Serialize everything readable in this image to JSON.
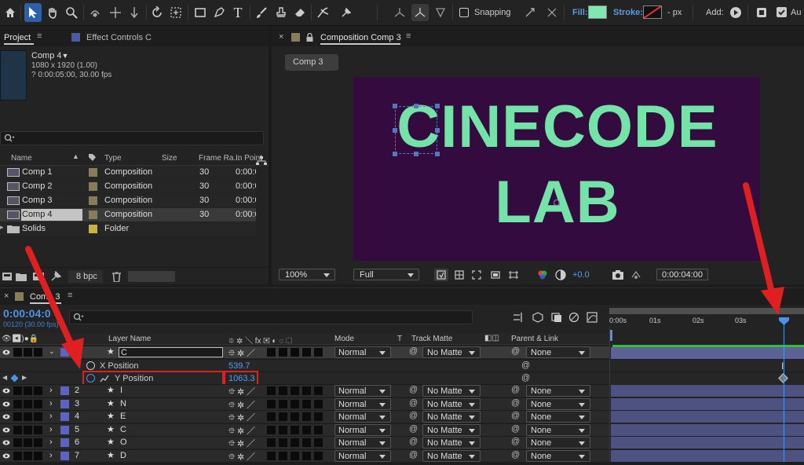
{
  "toolbar": {
    "tools": [
      "home-icon",
      "selection-icon",
      "hand-icon",
      "zoom-icon",
      "orbit-icon",
      "pan-icon",
      "dolly-icon",
      "rotate-icon",
      "pan-behind-icon",
      "rectangle-icon",
      "pen-icon",
      "type-icon",
      "brush-icon",
      "clone-stamp-icon",
      "eraser-icon",
      "roto-brush-icon",
      "puppet-icon"
    ],
    "snapping_label": "Snapping",
    "fill_label": "Fill:",
    "stroke_label": "Stroke:",
    "stroke_unit": "- px",
    "add_label": "Add:",
    "cut_label": "Au",
    "fill_color": "#7ee8b0",
    "stroke_color": "#e53030"
  },
  "project": {
    "tab_label": "Project",
    "effects_tab_label": "Effect Controls C",
    "selected_name": "Comp 4",
    "selected_info1": "1080 x 1920 (1.00)",
    "selected_info2": "? 0:00:05:00, 30.00 fps",
    "search_placeholder": "",
    "columns": {
      "name": "Name",
      "type": "Type",
      "size": "Size",
      "frame_rate": "Frame Ra...",
      "in_point": "In Point"
    },
    "items": [
      {
        "name": "Comp 1",
        "type": "Composition",
        "frame_rate": "30",
        "in_point": "0:00:0",
        "label_color": "#8a7c5a"
      },
      {
        "name": "Comp 2",
        "type": "Composition",
        "frame_rate": "30",
        "in_point": "0:00:0",
        "label_color": "#8a7c5a"
      },
      {
        "name": "Comp 3",
        "type": "Composition",
        "frame_rate": "30",
        "in_point": "0:00:0",
        "label_color": "#8a7c5a"
      },
      {
        "name": "Comp 4",
        "type": "Composition",
        "frame_rate": "30",
        "in_point": "0:00:0",
        "label_color": "#8a7c5a"
      },
      {
        "name": "Solids",
        "type": "Folder",
        "frame_rate": "",
        "in_point": "",
        "label_color": "#c9b33a"
      }
    ],
    "bpc_label": "8 bpc"
  },
  "composition": {
    "tab_label": "Composition Comp 3",
    "breadcrumb": "Comp 3",
    "canvas_bg": "#330b3f",
    "text_color": "#73e3a8",
    "line1": "CINECODE",
    "line2": "LAB",
    "zoom": "100%",
    "resolution": "Full",
    "exposure": "+0.0",
    "timecode": "0:00:04:00"
  },
  "timeline": {
    "tab_label": "Comp 3",
    "current_time": "0:00:04:0",
    "frame_info": "00120 (30.00 fps)",
    "col_layer_name": "Layer Name",
    "col_mode": "Mode",
    "col_t": "T",
    "col_track_matte": "Track Matte",
    "col_parent": "Parent & Link",
    "ruler": [
      "0:00s",
      "01s",
      "02s",
      "03s"
    ],
    "top_layer": {
      "name": "C",
      "mode": "Normal",
      "matte": "No Matte",
      "parent": "None"
    },
    "x_position": {
      "label": "X Position",
      "value": "539.7"
    },
    "y_position": {
      "label": "Y Position",
      "value": "1063.3"
    },
    "layers": [
      {
        "num": "2",
        "name": "I",
        "mode": "Normal",
        "matte": "No Matte",
        "parent": "None"
      },
      {
        "num": "3",
        "name": "N",
        "mode": "Normal",
        "matte": "No Matte",
        "parent": "None"
      },
      {
        "num": "4",
        "name": "E",
        "mode": "Normal",
        "matte": "No Matte",
        "parent": "None"
      },
      {
        "num": "5",
        "name": "C",
        "mode": "Normal",
        "matte": "No Matte",
        "parent": "None"
      },
      {
        "num": "6",
        "name": "O",
        "mode": "Normal",
        "matte": "No Matte",
        "parent": "None"
      },
      {
        "num": "7",
        "name": "D",
        "mode": "Normal",
        "matte": "No Matte",
        "parent": "None"
      }
    ],
    "label_color": "#5b63c9",
    "highlight_color": "#e02020"
  }
}
